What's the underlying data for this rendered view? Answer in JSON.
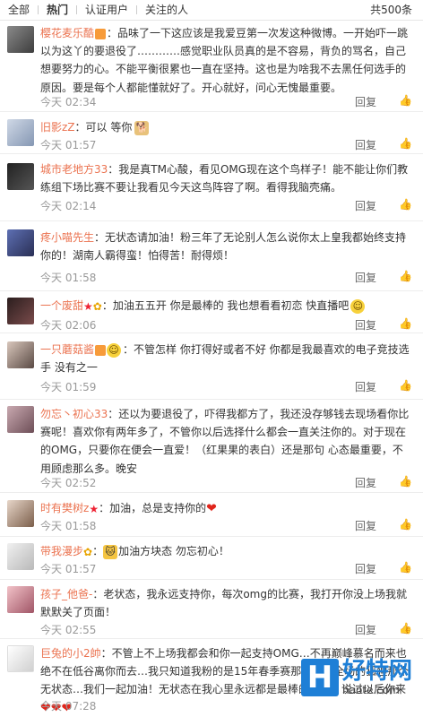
{
  "tabs": [
    {
      "label": "全部"
    },
    {
      "label": "热门"
    },
    {
      "label": "认证用户"
    },
    {
      "label": "关注的人"
    }
  ],
  "total": "共500条",
  "reply_label": "回复",
  "comments": [
    {
      "user": "樱花麦乐酷",
      "text": "：品味了一下这应该是我爱豆第一次发这种微博。一开始吓一跳以为这丫的要退役了…………感觉职业队员真的是不容易，背负的骂名，自己想要努力的心。不能平衡很累也一直在坚持。这也是为啥我不去黑任何选手的原因。要是每个人都能懂就好了。开心就好，问心无愧最重要。",
      "time": "今天 02:34"
    },
    {
      "user": "旧影zZ",
      "text": "：可以 等你",
      "time": "今天 01:57"
    },
    {
      "user": "城市老地方33",
      "text": "：我是真TM心酸，看见OMG现在这个鸟样子！能不能让你们教练组下场比赛不要让我看见今天这鸟阵容了啊。看得我脑壳痛。",
      "time": "今天 02:14"
    },
    {
      "user": "疼小喵先生",
      "text": "：无状态请加油！粉三年了无论别人怎么说你太上皇我都始终支持你的！湖南人霸得蛮！怕得苦！耐得烦！",
      "time": "今天 01:58"
    },
    {
      "user": "一个废甜",
      "text": "：加油五五开 你是最棒的 我也想看看初恋 快直播吧",
      "time": "今天 02:06"
    },
    {
      "user": "一只蘑菇酱",
      "text": "：不管怎样 你打得好或者不好 你都是我最喜欢的电子竞技选手 没有之一",
      "time": "今天 01:59"
    },
    {
      "user": "勿忘丶初心33",
      "text": "：还以为要退役了，吓得我都方了，我还没存够钱去现场看你比赛呢！喜欢你有两年多了，不管你以后选择什么都会一直关注你的。对于现在的OMG，只要你在便会一直爱！（红果果的表白）还是那句 心态最重要，不用顾虑那么多。晚安",
      "time": "今天 02:52"
    },
    {
      "user": "时有樊树z",
      "text": "：加油，总是支持你的",
      "time": "今天 01:58"
    },
    {
      "user": "带我漫步",
      "text": "加油方块态 勿忘初心！",
      "time": "今天 01:57"
    },
    {
      "user": "孩子_他爸-",
      "text": "：老状态，我永远支持你，每次omg的比赛，我打开你没上场我就默默关了页面！",
      "time": "今天 02:55"
    },
    {
      "user": "巨兔的小2帥",
      "text": "：不管上不上场我都会和你一起支持OMG…不再巅峰慕名而来也绝不在低谷离你而去…我只知道我粉的是15年春季赛那个秀翻全场的狐狸那个无状态…我们一起加油！无状态在我心里永远都是最棒的～谁，说过以后你来",
      "time": "今天 07:28"
    }
  ],
  "watermark": {
    "cn": "好特网",
    "url": "haote.com"
  }
}
